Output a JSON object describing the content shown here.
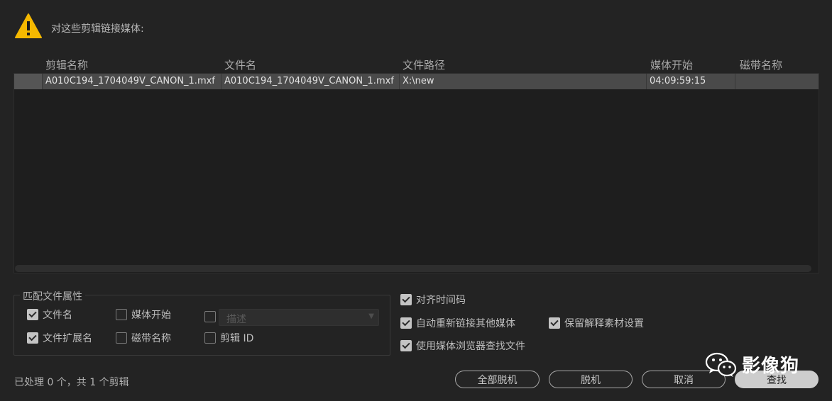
{
  "header": {
    "message": "对这些剪辑链接媒体:",
    "icon": "warning-icon",
    "icon_color": "#f5b800"
  },
  "table": {
    "columns": [
      "剪辑名称",
      "文件名",
      "文件路径",
      "媒体开始",
      "磁带名称"
    ],
    "rows": [
      {
        "clip_name": "A010C194_1704049V_CANON_1.mxf",
        "file_name": "A010C194_1704049V_CANON_1.mxf",
        "file_path": "X:\\new",
        "media_start": "04:09:59:15",
        "tape_name": ""
      }
    ]
  },
  "match_group": {
    "title": "匹配文件属性",
    "options": {
      "file_name": {
        "label": "文件名",
        "checked": true
      },
      "media_start": {
        "label": "媒体开始",
        "checked": false
      },
      "description": {
        "label": "描述",
        "checked": false,
        "disabled": true
      },
      "file_extension": {
        "label": "文件扩展名",
        "checked": true
      },
      "tape_name": {
        "label": "磁带名称",
        "checked": false
      },
      "clip_id": {
        "label": "剪辑 ID",
        "checked": false
      }
    }
  },
  "options": {
    "align_timecode": {
      "label": "对齐时间码",
      "checked": true
    },
    "relink_others": {
      "label": "自动重新链接其他媒体",
      "checked": true
    },
    "preserve_interpret": {
      "label": "保留解释素材设置",
      "checked": true
    },
    "use_media_browser": {
      "label": "使用媒体浏览器查找文件",
      "checked": true
    }
  },
  "status": "已处理 0 个，共 1 个剪辑",
  "buttons": {
    "offline_all": "全部脱机",
    "offline": "脱机",
    "cancel": "取消",
    "find": "查找"
  },
  "watermark": {
    "text": "影像狗",
    "icon": "wechat-icon"
  }
}
